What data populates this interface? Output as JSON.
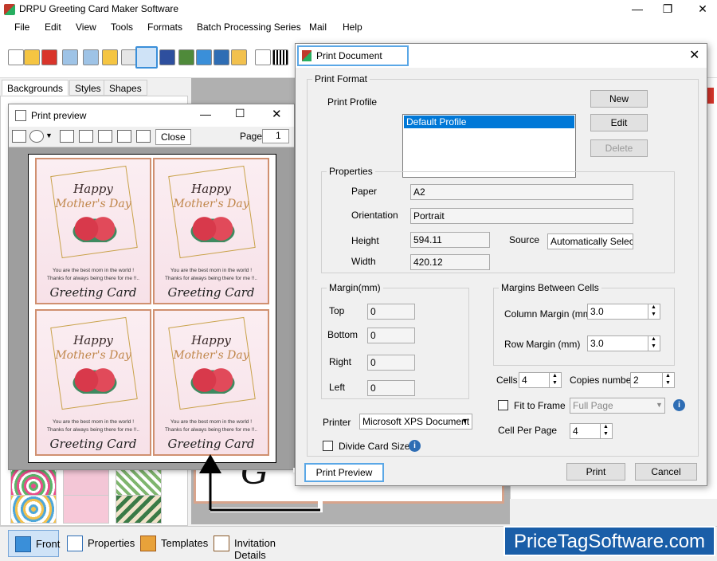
{
  "app": {
    "title": "DRPU Greeting Card Maker Software"
  },
  "menu": [
    "File",
    "Edit",
    "View",
    "Tools",
    "Formats",
    "Batch Processing Series",
    "Mail",
    "Help"
  ],
  "left_tabs": [
    "Backgrounds",
    "Styles",
    "Shapes"
  ],
  "bottom_tabs": [
    "Front",
    "Properties",
    "Templates",
    "Invitation Details"
  ],
  "brand": "PriceTagSoftware.com",
  "print_preview": {
    "title": "Print preview",
    "close_label": "Close",
    "page_label": "Page",
    "page_value": "1",
    "card": {
      "line1": "Happy",
      "line2": "Mother's Day",
      "text1": "You are the best mom in the world !",
      "text2": "Thanks for always being there for me !!..",
      "footer": "Greeting Card"
    }
  },
  "print_document": {
    "title": "Print Document",
    "print_format_label": "Print Format",
    "print_profile_label": "Print Profile",
    "profile_selected": "Default Profile",
    "new_label": "New",
    "edit_label": "Edit",
    "delete_label": "Delete",
    "properties_label": "Properties",
    "paper_label": "Paper",
    "paper_value": "A2",
    "orientation_label": "Orientation",
    "orientation_value": "Portrait",
    "height_label": "Height",
    "height_value": "594.11",
    "source_label": "Source",
    "source_value": "Automatically Select",
    "width_label": "Width",
    "width_value": "420.12",
    "margin_label": "Margin(mm)",
    "top_label": "Top",
    "top_value": "0",
    "bottom_label": "Bottom",
    "bottom_value": "0",
    "right_label": "Right",
    "right_value": "0",
    "left_label": "Left",
    "left_value": "0",
    "cells_margin_label": "Margins Between Cells",
    "column_margin_label": "Column Margin (mm)",
    "column_margin_value": "3.0",
    "row_margin_label": "Row Margin (mm)",
    "row_margin_value": "3.0",
    "cells_label": "Cells",
    "cells_value": "4",
    "copies_label": "Copies number",
    "copies_value": "2",
    "fit_to_frame_label": "Fit to Frame",
    "fit_to_frame_value": "Full Page",
    "cell_per_page_label": "Cell Per Page",
    "cell_per_page_value": "4",
    "printer_label": "Printer",
    "printer_value": "Microsoft XPS Document Writer",
    "divide_card_label": "Divide Card Size",
    "print_preview_label": "Print Preview",
    "print_label": "Print",
    "cancel_label": "Cancel"
  }
}
